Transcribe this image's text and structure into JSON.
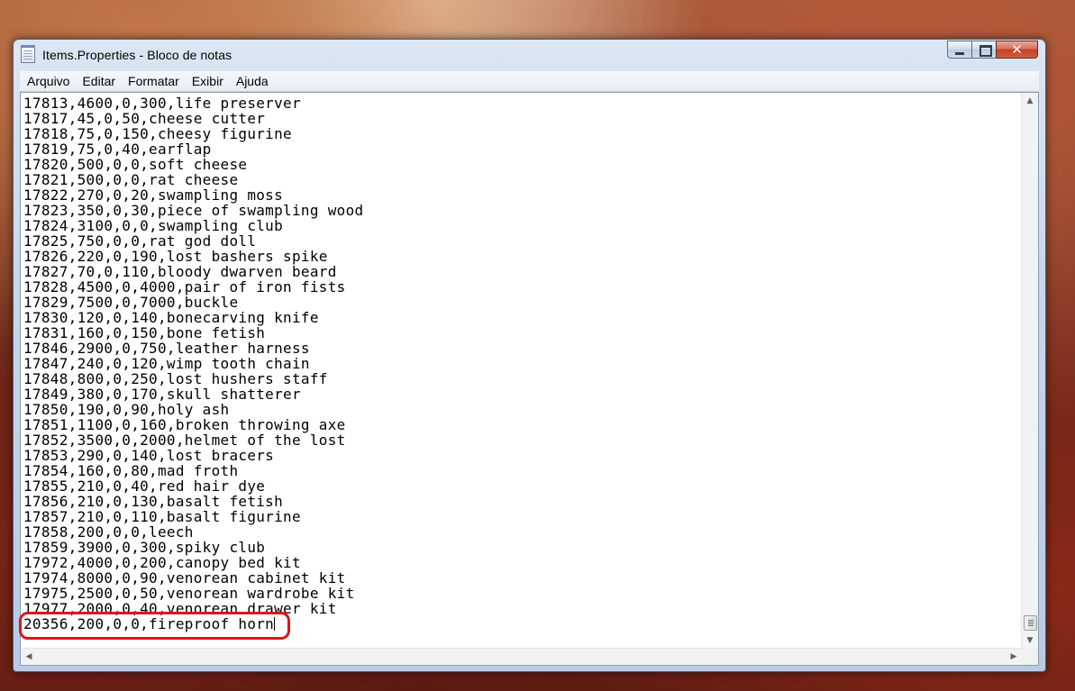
{
  "window": {
    "title": "Items.Properties - Bloco de notas"
  },
  "menu": [
    "Arquivo",
    "Editar",
    "Formatar",
    "Exibir",
    "Ajuda"
  ],
  "caption": {
    "close_glyph": "✕"
  },
  "lines": [
    "17813,4600,0,300,life preserver",
    "17817,45,0,50,cheese cutter",
    "17818,75,0,150,cheesy figurine",
    "17819,75,0,40,earflap",
    "17820,500,0,0,soft cheese",
    "17821,500,0,0,rat cheese",
    "17822,270,0,20,swampling moss",
    "17823,350,0,30,piece of swampling wood",
    "17824,3100,0,0,swampling club",
    "17825,750,0,0,rat god doll",
    "17826,220,0,190,lost bashers spike",
    "17827,70,0,110,bloody dwarven beard",
    "17828,4500,0,4000,pair of iron fists",
    "17829,7500,0,7000,buckle",
    "17830,120,0,140,bonecarving knife",
    "17831,160,0,150,bone fetish",
    "17846,2900,0,750,leather harness",
    "17847,240,0,120,wimp tooth chain",
    "17848,800,0,250,lost hushers staff",
    "17849,380,0,170,skull shatterer",
    "17850,190,0,90,holy ash",
    "17851,1100,0,160,broken throwing axe",
    "17852,3500,0,2000,helmet of the lost",
    "17853,290,0,140,lost bracers",
    "17854,160,0,80,mad froth",
    "17855,210,0,40,red hair dye",
    "17856,210,0,130,basalt fetish",
    "17857,210,0,110,basalt figurine",
    "17858,200,0,0,leech",
    "17859,3900,0,300,spiky club",
    "17972,4000,0,200,canopy bed kit",
    "17974,8000,0,90,venorean cabinet kit",
    "17975,2500,0,50,venorean wardrobe kit",
    "17977,2000,0,40,venorean drawer kit"
  ],
  "last_line": "20356,200,0,0,fireproof horn",
  "colors": {
    "highlight": "#e0151a"
  }
}
